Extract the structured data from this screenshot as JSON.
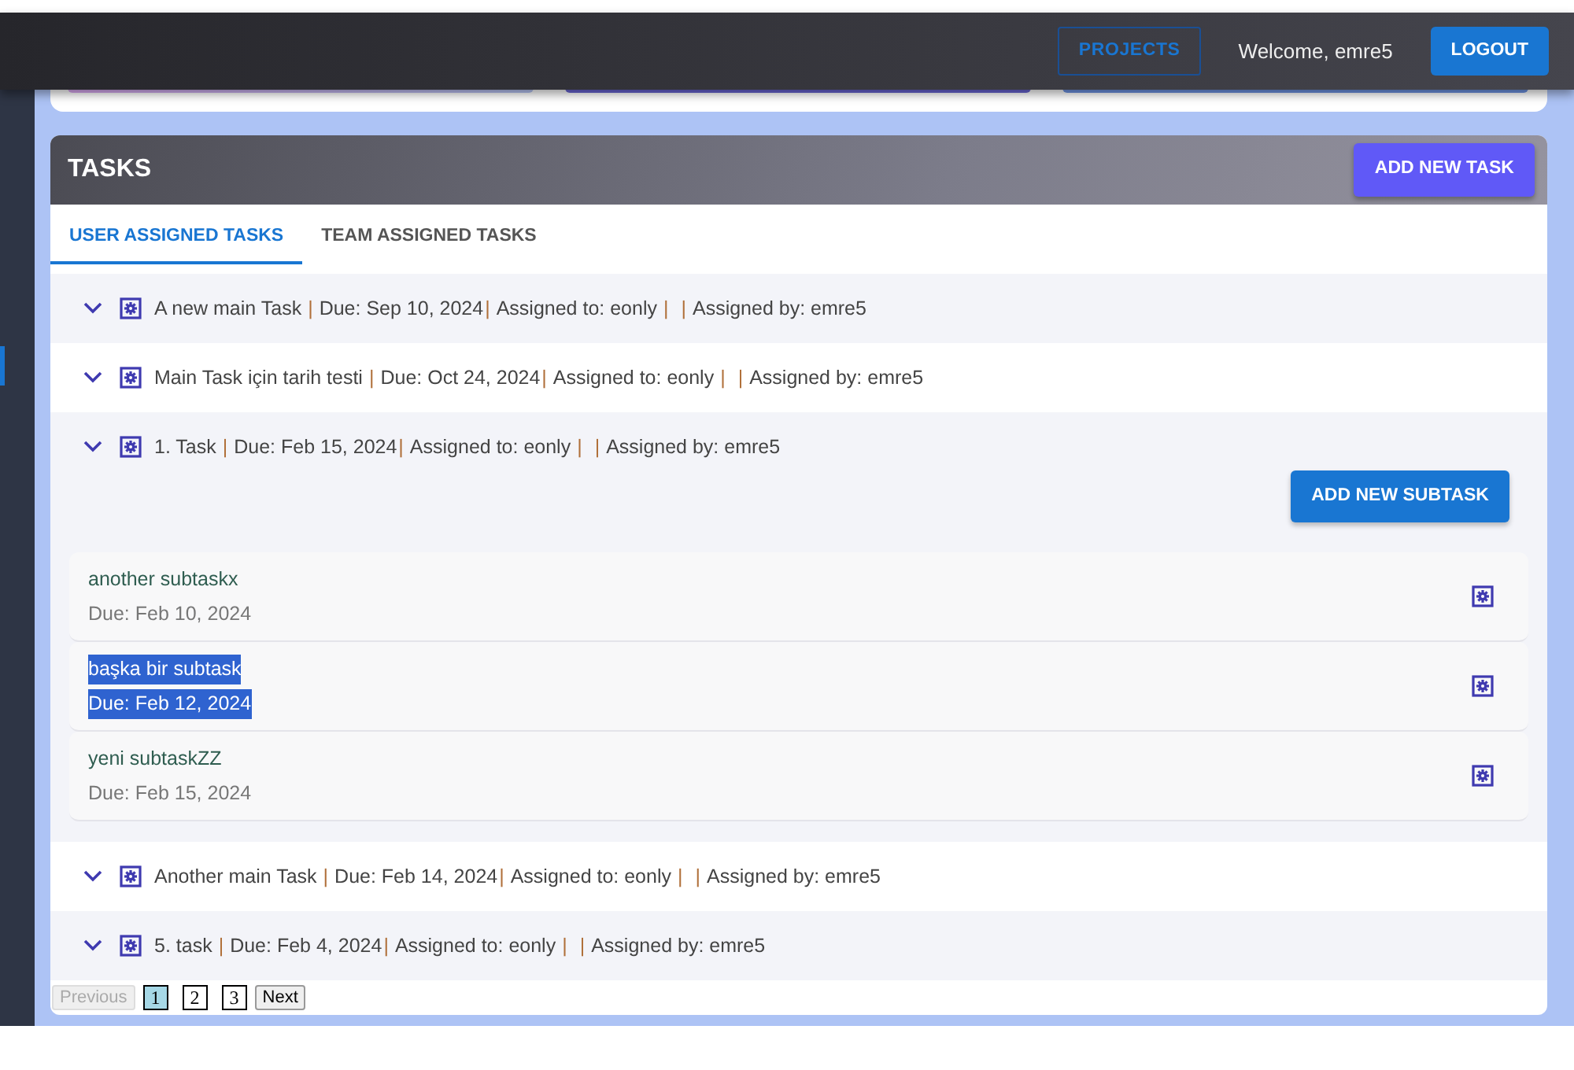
{
  "navbar": {
    "projects_button": "PROJECTS",
    "welcome": "Welcome, emre5",
    "logout_button": "LOGOUT"
  },
  "tasks_card": {
    "title": "TASKS",
    "add_button": "ADD NEW TASK",
    "tabs": [
      {
        "label": "USER ASSIGNED TASKS",
        "selected": true
      },
      {
        "label": "TEAM ASSIGNED TASKS",
        "selected": false
      }
    ],
    "tasks": [
      {
        "expanded": false,
        "parts": [
          {
            "kind": "title",
            "text": "A new main Task"
          },
          {
            "kind": "separator",
            "text": "|"
          },
          {
            "kind": "due",
            "text": "Due: Sep 10, 2024"
          },
          {
            "kind": "separator",
            "text": "|"
          },
          {
            "kind": "assignee",
            "text": "Assigned to: eonly"
          },
          {
            "kind": "separator",
            "text": "|"
          },
          {
            "kind": "separator",
            "text": "|"
          },
          {
            "kind": "assigner",
            "text": "Assigned by: emre5"
          }
        ]
      },
      {
        "expanded": false,
        "parts": [
          {
            "kind": "title",
            "text": "Main Task için tarih testi"
          },
          {
            "kind": "separator",
            "text": "|"
          },
          {
            "kind": "due",
            "text": "Due: Oct 24, 2024"
          },
          {
            "kind": "separator",
            "text": "|"
          },
          {
            "kind": "assignee",
            "text": "Assigned to: eonly"
          },
          {
            "kind": "separator",
            "text": "|"
          },
          {
            "kind": "separator",
            "text": "|"
          },
          {
            "kind": "assigner",
            "text": "Assigned by: emre5"
          }
        ]
      },
      {
        "expanded": true,
        "parts": [
          {
            "kind": "title",
            "text": "1. Task"
          },
          {
            "kind": "separator",
            "text": "|"
          },
          {
            "kind": "due",
            "text": "Due: Feb 15, 2024"
          },
          {
            "kind": "separator",
            "text": "|"
          },
          {
            "kind": "assignee",
            "text": "Assigned to: eonly"
          },
          {
            "kind": "separator",
            "text": "|"
          },
          {
            "kind": "separator",
            "text": "|"
          },
          {
            "kind": "assigner",
            "text": "Assigned by: emre5"
          }
        ],
        "add_subtask_button": "ADD NEW SUBTASK",
        "subtasks": [
          {
            "name": "another subtaskx",
            "due": "Due: Feb 10, 2024",
            "highlighted": false
          },
          {
            "name": "başka bir subtask",
            "due": "Due: Feb 12, 2024",
            "highlighted": true
          },
          {
            "name": "yeni subtaskZZ",
            "due": "Due: Feb 15, 2024",
            "highlighted": false
          }
        ]
      },
      {
        "expanded": false,
        "parts": [
          {
            "kind": "title",
            "text": "Another main Task"
          },
          {
            "kind": "separator",
            "text": "|"
          },
          {
            "kind": "due",
            "text": "Due: Feb 14, 2024"
          },
          {
            "kind": "separator",
            "text": "|"
          },
          {
            "kind": "assignee",
            "text": "Assigned to: eonly"
          },
          {
            "kind": "separator",
            "text": "|"
          },
          {
            "kind": "separator",
            "text": "|"
          },
          {
            "kind": "assigner",
            "text": "Assigned by: emre5"
          }
        ]
      },
      {
        "expanded": false,
        "parts": [
          {
            "kind": "title",
            "text": "5. task"
          },
          {
            "kind": "separator",
            "text": "|"
          },
          {
            "kind": "due",
            "text": "Due: Feb 4, 2024"
          },
          {
            "kind": "separator",
            "text": "|"
          },
          {
            "kind": "assignee",
            "text": "Assigned to: eonly"
          },
          {
            "kind": "separator",
            "text": "|"
          },
          {
            "kind": "separator",
            "text": "|"
          },
          {
            "kind": "assigner",
            "text": "Assigned by: emre5"
          }
        ]
      }
    ],
    "pagination": [
      {
        "label": "Previous",
        "kind": "nav",
        "disabled": true,
        "selected": false
      },
      {
        "label": "1",
        "kind": "page",
        "disabled": false,
        "selected": true
      },
      {
        "label": "2",
        "kind": "page",
        "disabled": false,
        "selected": false
      },
      {
        "label": "3",
        "kind": "page",
        "disabled": false,
        "selected": false
      },
      {
        "label": "Next",
        "kind": "nav",
        "disabled": false,
        "selected": false
      }
    ]
  }
}
